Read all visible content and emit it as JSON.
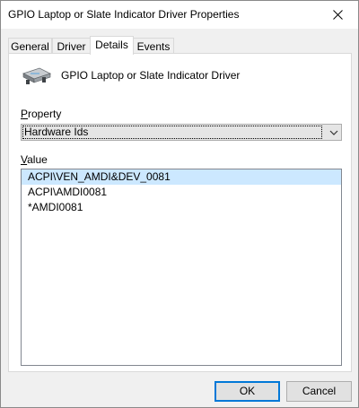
{
  "window": {
    "title": "GPIO Laptop or Slate Indicator Driver Properties"
  },
  "tabs": [
    {
      "label": "General",
      "active": false
    },
    {
      "label": "Driver",
      "active": false
    },
    {
      "label": "Details",
      "active": true
    },
    {
      "label": "Events",
      "active": false
    }
  ],
  "details": {
    "device_name": "GPIO Laptop or Slate Indicator Driver",
    "device_icon": "device-icon",
    "property_label_accel": "P",
    "property_label_rest": "roperty",
    "property_selected": "Hardware Ids",
    "value_label_accel": "V",
    "value_label_rest": "alue",
    "values": [
      "ACPI\\VEN_AMDI&DEV_0081",
      "ACPI\\AMDI0081",
      "*AMDI0081"
    ],
    "selected_index": 0
  },
  "buttons": {
    "ok": "OK",
    "cancel": "Cancel"
  },
  "colors": {
    "selection": "#cce8ff",
    "default_button_border": "#0078d7",
    "dialog_background": "#f0f0f0"
  }
}
